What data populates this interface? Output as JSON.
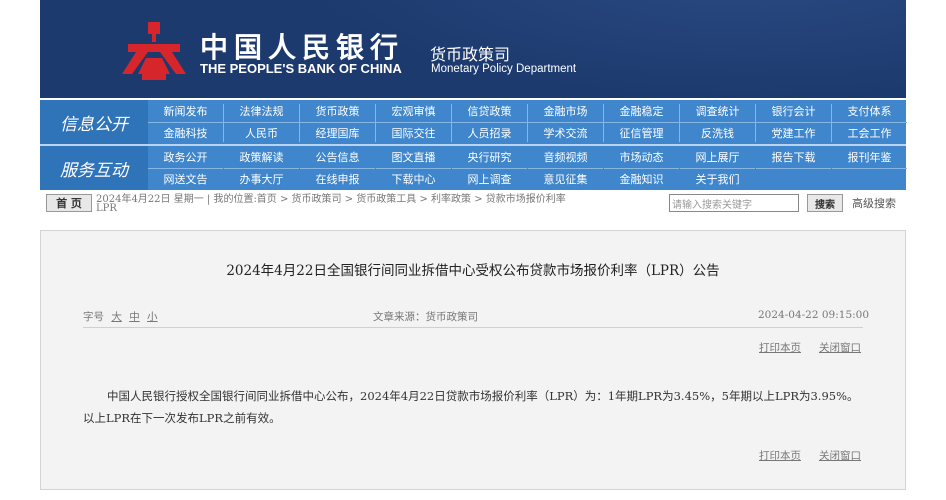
{
  "header": {
    "title_cn": "中国人民银行",
    "title_en": "THE PEOPLE'S BANK OF CHINA",
    "dept_cn": "货币政策司",
    "dept_en": "Monetary Policy Department",
    "colors": {
      "banner": "#1d3a6e",
      "nav": "#3f86cc",
      "logo": "#d6262b"
    }
  },
  "nav": {
    "label_info": "信息公开",
    "label_service": "服务互动",
    "row1": [
      "新闻发布",
      "法律法规",
      "货币政策",
      "宏观审慎",
      "信贷政策",
      "金融市场",
      "金融稳定",
      "调查统计",
      "银行会计",
      "支付体系"
    ],
    "row2": [
      "金融科技",
      "人民币",
      "经理国库",
      "国际交往",
      "人员招录",
      "学术交流",
      "征信管理",
      "反洗钱",
      "党建工作",
      "工会工作"
    ],
    "row3": [
      "政务公开",
      "政策解读",
      "公告信息",
      "图文直播",
      "央行研究",
      "音频视频",
      "市场动态",
      "网上展厅",
      "报告下载",
      "报刊年鉴"
    ],
    "row4": [
      "网送文告",
      "办事大厅",
      "在线申报",
      "下载中心",
      "网上调查",
      "意见征集",
      "金融知识",
      "关于我们"
    ]
  },
  "breadcrumb": {
    "home_label": "首 页",
    "date_text": "2024年4月22日  星期一  |  我的位置:首页   >   货币政策司   >   货币政策工具   >   利率政策   >   贷款市场报价利率",
    "tail": "LPR",
    "search_placeholder": "请输入搜索关键字",
    "search_button": "搜索",
    "advanced_search": "高级搜索"
  },
  "article": {
    "title": "2024年4月22日全国银行间同业拆借中心受权公布贷款市场报价利率（LPR）公告",
    "font_label": "字号",
    "font_large": "大",
    "font_medium": "中",
    "font_small": "小",
    "source": "文章来源：货币政策司",
    "datetime": "2024-04-22  09:15:00",
    "print": "打印本页",
    "close": "关闭窗口",
    "body": "中国人民银行授权全国银行间同业拆借中心公布，2024年4月22日贷款市场报价利率（LPR）为：1年期LPR为3.45%，5年期以上LPR为3.95%。以上LPR在下一次发布LPR之前有效。",
    "print2": "打印本页",
    "close2": "关闭窗口"
  }
}
